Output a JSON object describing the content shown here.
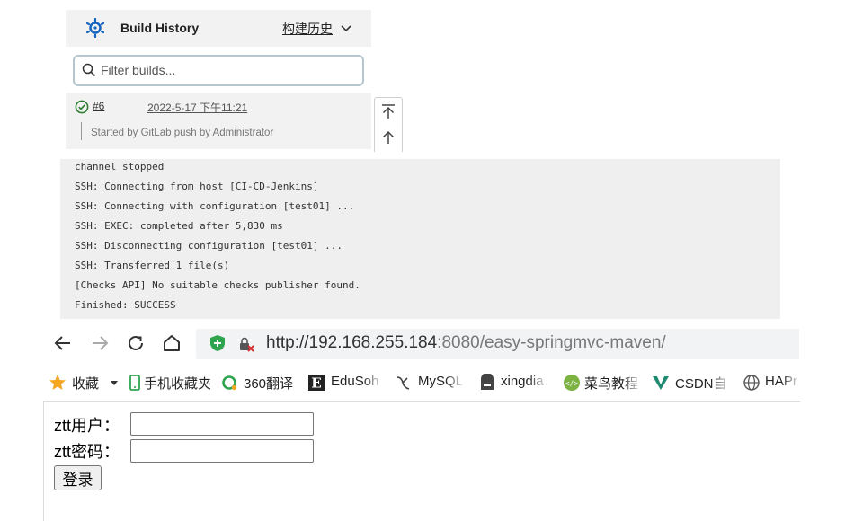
{
  "build_history": {
    "title": "Build History",
    "title_cn": "构建历史",
    "search_placeholder": "Filter builds...",
    "entry": {
      "number": "#6",
      "date": "2022-5-17 下午11:21",
      "description": "Started by GitLab push by Administrator",
      "status": "success"
    }
  },
  "console": {
    "lines": [
      "channel stopped",
      "SSH: Connecting from host [CI-CD-Jenkins]",
      "SSH: Connecting with configuration [test01] ...",
      "SSH: EXEC: completed after 5,830 ms",
      "SSH: Disconnecting configuration [test01] ...",
      "SSH: Transferred 1 file(s)",
      "[Checks API] No suitable checks publisher found.",
      "Finished: SUCCESS"
    ]
  },
  "browser": {
    "url_scheme_host": "http://192.168.255.184",
    "url_rest": ":8080/easy-springmvc-maven/",
    "bookmarks": [
      {
        "label": "收藏",
        "icon": "star-icon"
      },
      {
        "label": "手机收藏夹",
        "icon": "phone-icon"
      },
      {
        "label": "360翻译",
        "icon": "translate-icon"
      },
      {
        "label": "EduSoh",
        "icon": "edusoho-icon"
      },
      {
        "label": "MySQL",
        "icon": "mysql-icon"
      },
      {
        "label": "xingdia",
        "icon": "xingdian-icon"
      },
      {
        "label": "菜鸟教程",
        "icon": "runoob-icon"
      },
      {
        "label": "CSDN自",
        "icon": "csdn-icon"
      },
      {
        "label": "HAPr",
        "icon": "globe-icon"
      }
    ]
  },
  "login_form": {
    "user_label": "ztt用户：",
    "password_label": "ztt密码：",
    "submit_label": "登录"
  },
  "colors": {
    "success": "#2e7d32",
    "jenkins_blue": "#1565c0",
    "star": "#f5a623",
    "shield": "#2ea44f",
    "csdn": "#1f8a70"
  }
}
